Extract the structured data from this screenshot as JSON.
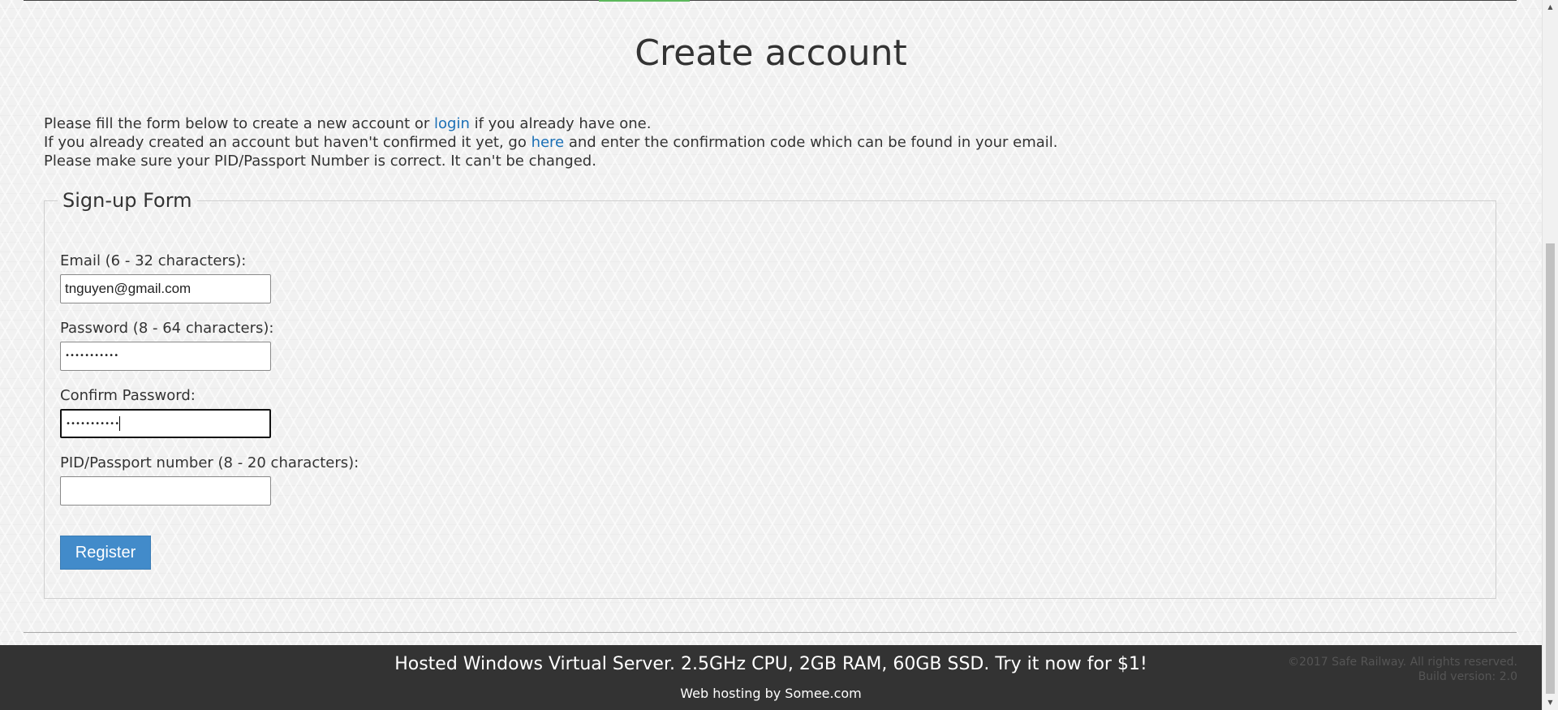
{
  "page": {
    "title": "Create account"
  },
  "intro": {
    "line1_pre": "Please fill the form below to create a new account or ",
    "login_link": "login",
    "line1_post": " if you already have one.",
    "line2_pre": "If you already created an account but haven't confirmed it yet, go ",
    "here_link": "here",
    "line2_post": " and enter the confirmation code which can be found in your email.",
    "line3": "Please make sure your PID/Passport Number is correct. It can't be changed."
  },
  "form": {
    "legend": "Sign-up Form",
    "email": {
      "label": "Email (6 - 32 characters):",
      "value": "tnguyen@gmail.com"
    },
    "password": {
      "label": "Password (8 - 64 characters):",
      "value": "•••••••••••"
    },
    "confirm_password": {
      "label": "Confirm Password:",
      "value": "•••••••••••"
    },
    "pid": {
      "label": "PID/Passport number (8 - 20 characters):",
      "value": ""
    },
    "register_label": "Register"
  },
  "footer": {
    "ad_text": "Hosted Windows Virtual Server. 2.5GHz CPU, 2GB RAM, 60GB SSD. Try it now for $1!",
    "hosting_text": "Web hosting by Somee.com",
    "copyright": "©2017 Safe Railway. All rights reserved.",
    "build": "Build version: 2.0"
  },
  "scrollbar": {
    "up_icon": "triangle-up-icon",
    "down_icon": "triangle-down-icon"
  }
}
